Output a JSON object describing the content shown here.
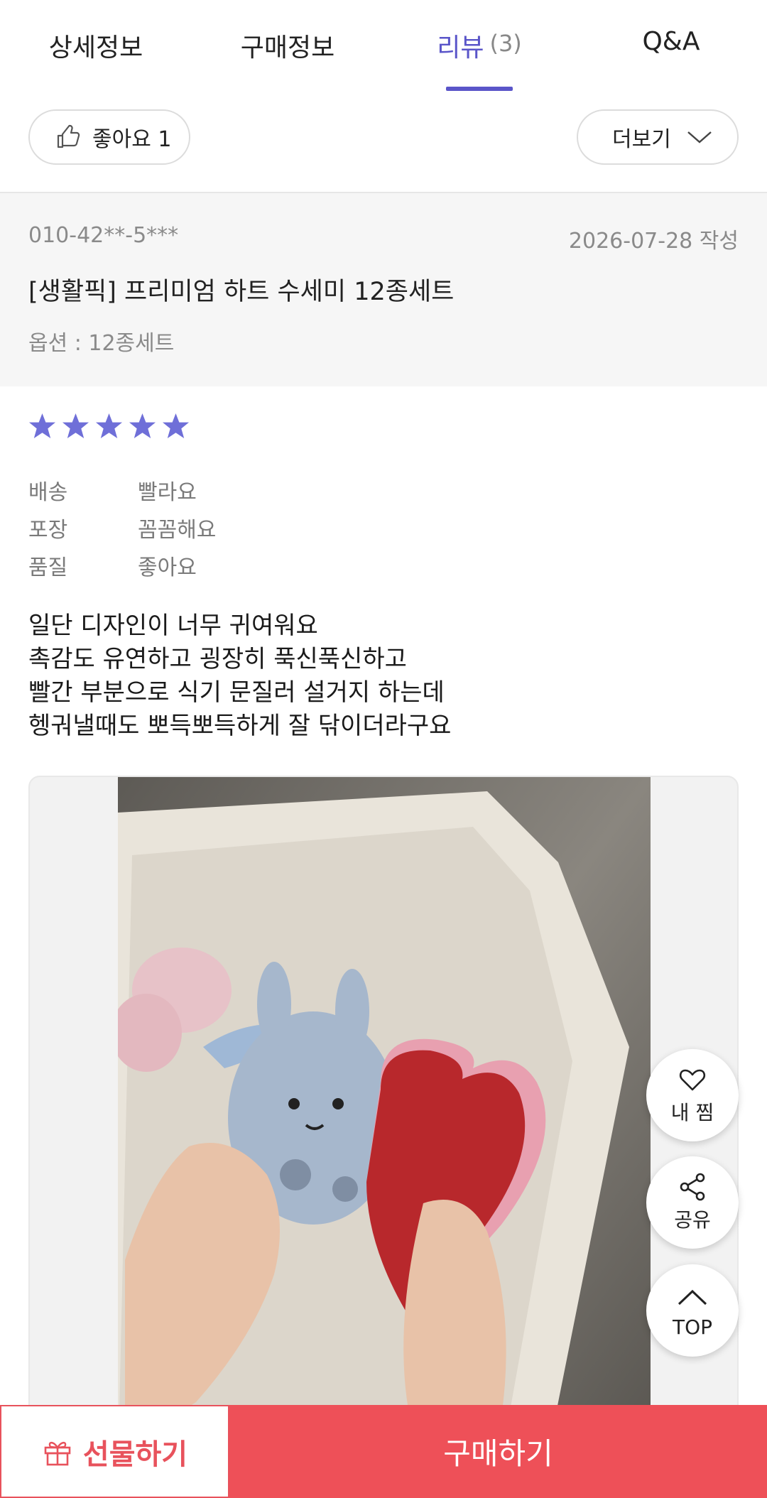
{
  "tabs": [
    {
      "label": "상세정보",
      "count": ""
    },
    {
      "label": "구매정보",
      "count": ""
    },
    {
      "label": "리뷰",
      "count": "(3)"
    },
    {
      "label": "Q&A",
      "count": ""
    }
  ],
  "active_tab": "리뷰",
  "actions": {
    "like_label": "좋아요 1",
    "more_label": "더보기"
  },
  "review": {
    "reviewer": "010-42**-5***",
    "date": "2026-07-28 작성",
    "product": "[생활픽] 프리미엄 하트 수세미 12종세트",
    "option": "옵션 : 12종세트",
    "stars": 5,
    "ratings": [
      {
        "label": "배송",
        "value": "빨라요"
      },
      {
        "label": "포장",
        "value": "꼼꼼해요"
      },
      {
        "label": "품질",
        "value": "좋아요"
      }
    ],
    "body_lines": [
      "일단 디자인이 너무 귀여워요",
      "촉감도 유연하고 굉장히 푹신푹신하고",
      "빨간 부분으로 식기 문질러 설거지 하는데",
      "헹궈낼때도 뽀득뽀득하게 잘 닦이더라구요"
    ]
  },
  "floating": {
    "wish_label": "내 찜",
    "share_label": "공유",
    "top_label": "TOP"
  },
  "bottom": {
    "gift_label": "선물하기",
    "buy_label": "구매하기"
  },
  "colors": {
    "accent": "#5a55c9",
    "star": "#6f6fd8",
    "buy": "#ee5058"
  }
}
